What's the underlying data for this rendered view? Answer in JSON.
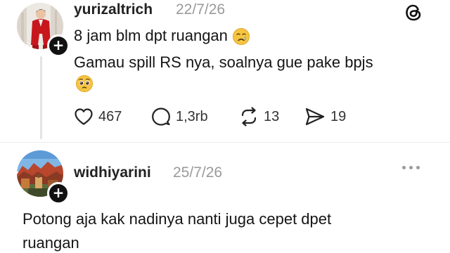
{
  "post": {
    "username": "yurizaltrich",
    "date": "22/7/26",
    "lines": [
      "8 jam blm dpt ruangan",
      "Gamau spill RS nya, soalnya gue pake bpjs"
    ],
    "emoji_1": "crying-face",
    "emoji_2": "pleading-face",
    "actions": {
      "likes": "467",
      "replies": "1,3rb",
      "reposts": "13",
      "shares": "19"
    }
  },
  "reply": {
    "username": "widhiyarini",
    "date": "25/7/26",
    "lines": [
      "Potong aja kak nadinya nanti juga cepet dpet",
      "ruangan"
    ]
  },
  "icons": {
    "brand": "threads-logo-icon",
    "like": "heart-icon",
    "reply": "comment-icon",
    "repost": "repost-icon",
    "share": "send-icon",
    "follow": "plus-icon",
    "more": "more-dots-icon"
  },
  "colors": {
    "date": "#9a9a9a",
    "emoji": "#f5c542",
    "avatar_bg_post": "#e7e2dc",
    "suit_red": "#c8161d"
  }
}
